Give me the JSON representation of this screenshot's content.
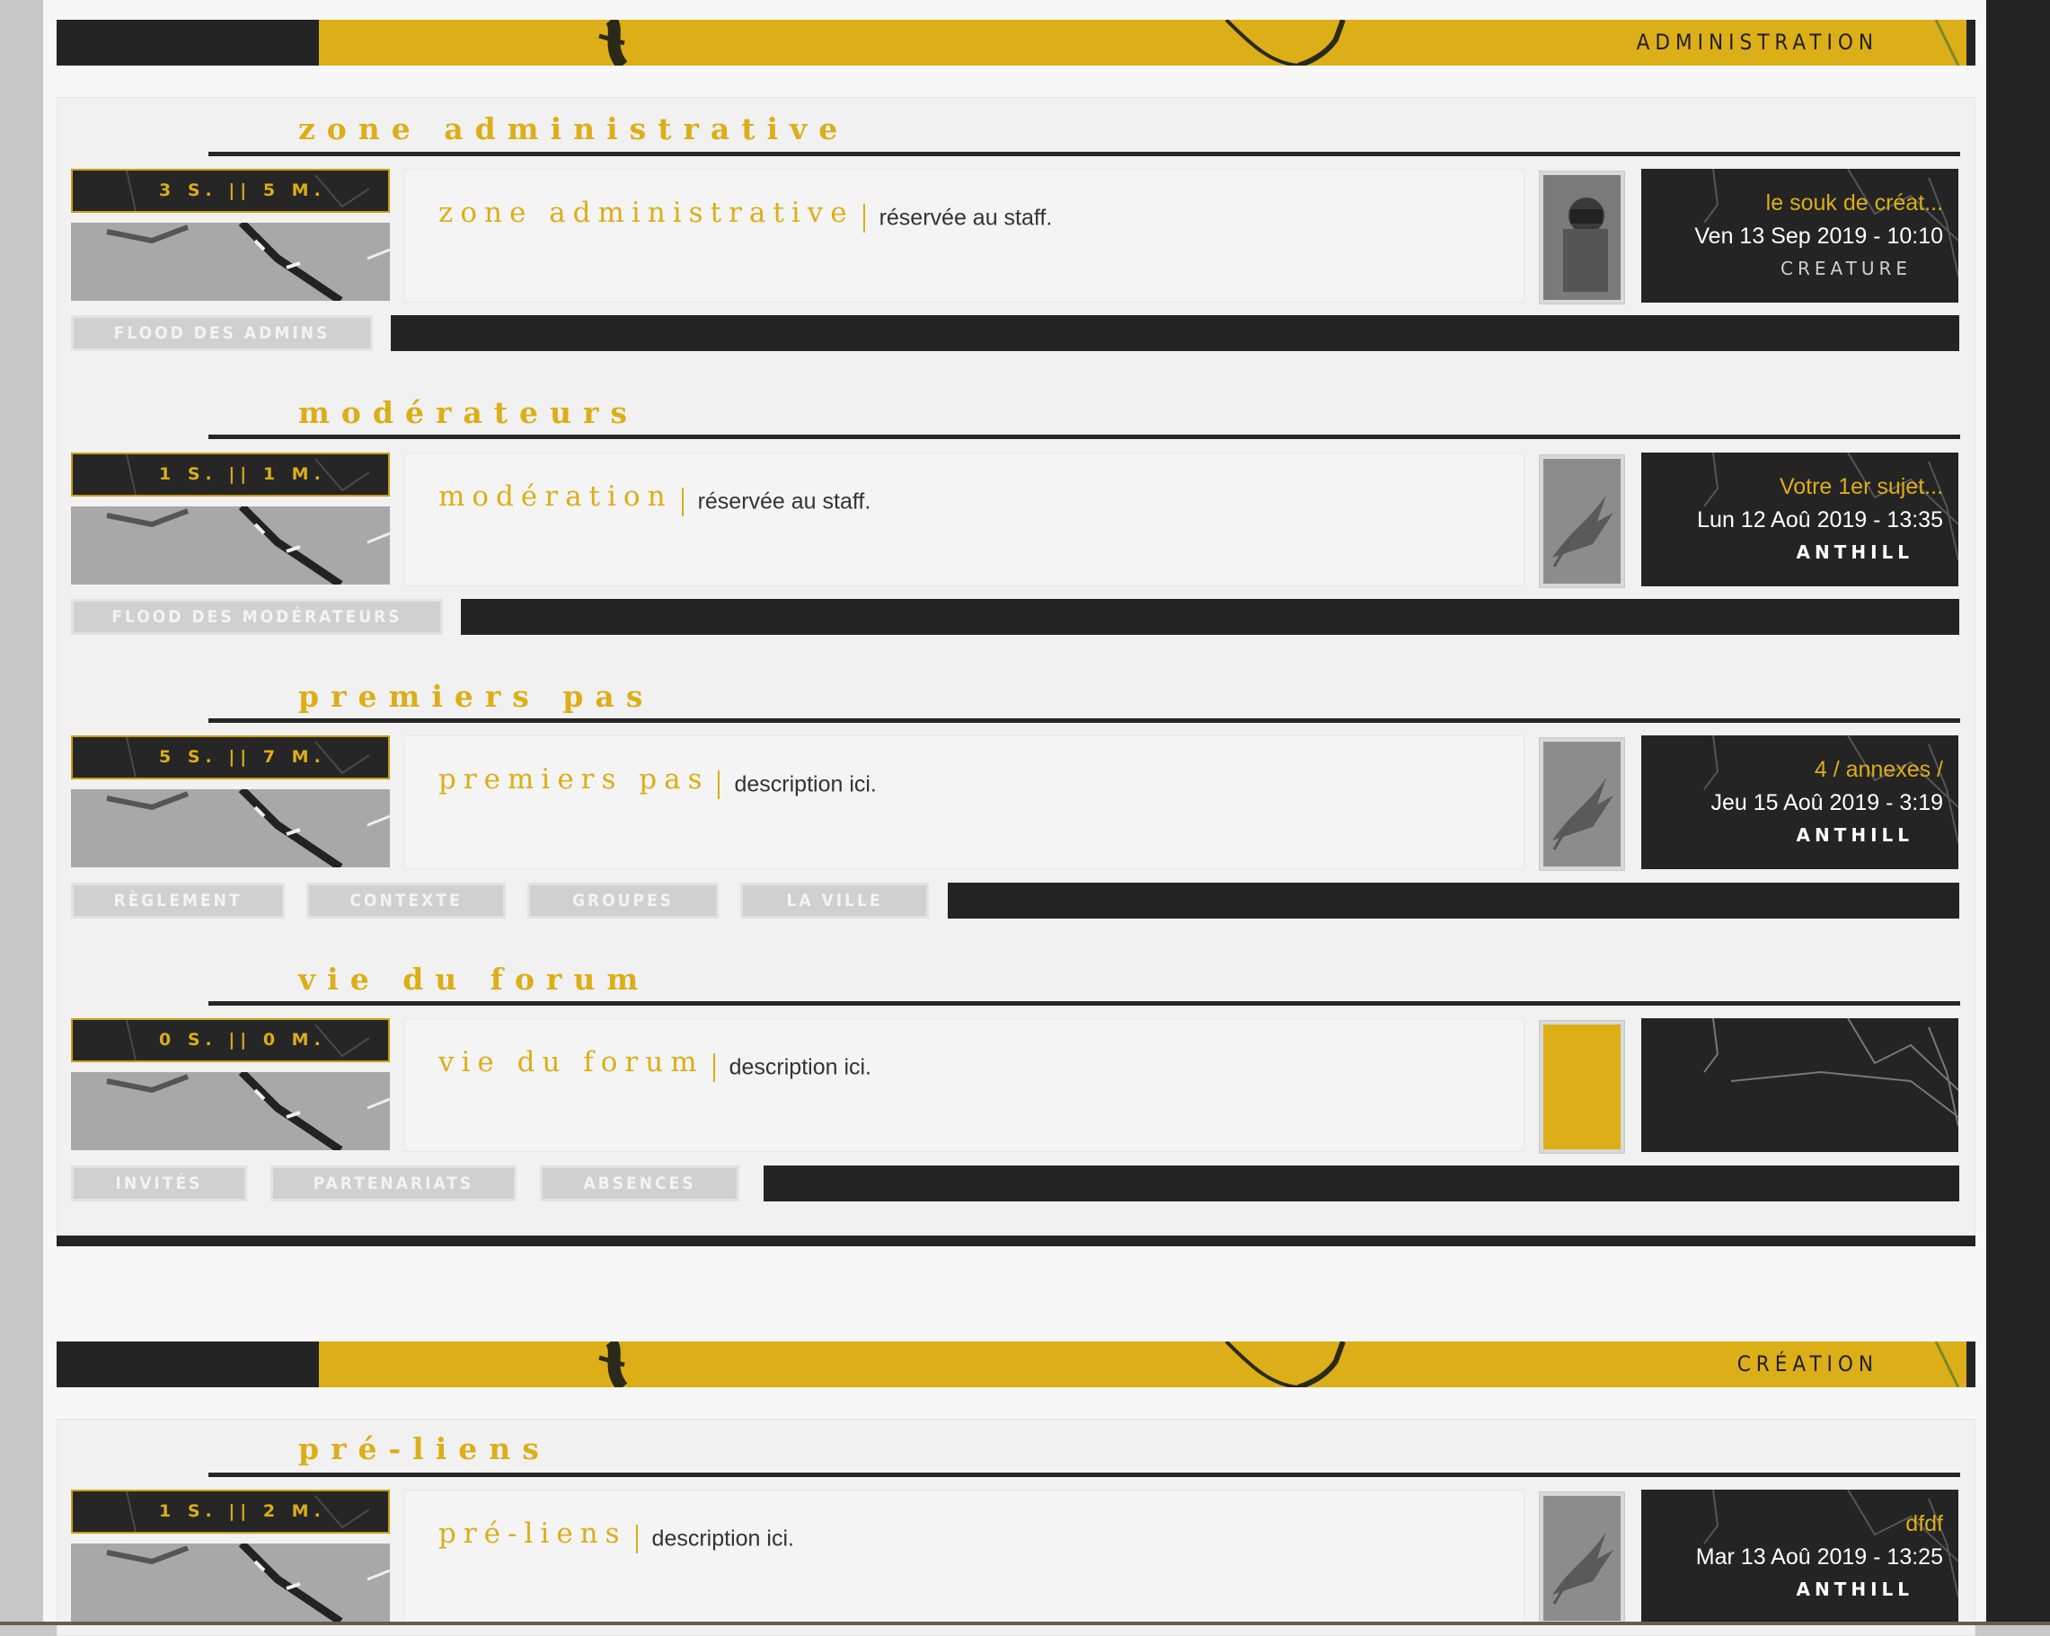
{
  "categories": [
    {
      "title": "ADMINISTRATION",
      "sections": [
        {
          "heading": "zone administrative",
          "stats": "3 S. || 5 M.",
          "forum_name": "zone administrative",
          "description": "réservée au staff.",
          "last_post": {
            "title": "le souk de créat...",
            "date": "Ven 13 Sep 2019 - 10:10",
            "author": "CREATURE"
          },
          "links": [
            "FLOOD DES ADMINS"
          ]
        },
        {
          "heading": "modérateurs",
          "stats": "1 S. || 1 M.",
          "forum_name": "modération",
          "description": "réservée au staff.",
          "last_post": {
            "title": "Votre 1er sujet...",
            "date": "Lun 12 Aoû 2019 - 13:35",
            "author": "ANTHILL"
          },
          "links": [
            "FLOOD DES MODÉRATEURS"
          ]
        },
        {
          "heading": "premiers pas",
          "stats": "5 S. || 7 M.",
          "forum_name": "premiers pas",
          "description": "description ici.",
          "last_post": {
            "title": "4 / annexes /",
            "date": "Jeu 15 Aoû 2019 - 3:19",
            "author": "ANTHILL"
          },
          "links": [
            "RÈGLEMENT",
            "CONTEXTE",
            "GROUPES",
            "LA VILLE"
          ]
        },
        {
          "heading": "vie du forum",
          "stats": "0 S. || 0 M.",
          "forum_name": "vie du forum",
          "description": "description ici.",
          "last_post": null,
          "links": [
            "INVITÉS",
            "PARTENARIATS",
            "ABSENCES"
          ]
        }
      ]
    },
    {
      "title": "CRÉATION",
      "sections": [
        {
          "heading": "pré-liens",
          "stats": "1 S. || 2 M.",
          "forum_name": "pré-liens",
          "description": "description ici.",
          "last_post": {
            "title": "dfdf",
            "date": "Mar 13 Aoû 2019 - 13:25",
            "author": "ANTHILL"
          }
        }
      ]
    }
  ],
  "colors": {
    "accent": "#dcae17",
    "dark": "#242424",
    "panel": "#f4f4f4"
  }
}
